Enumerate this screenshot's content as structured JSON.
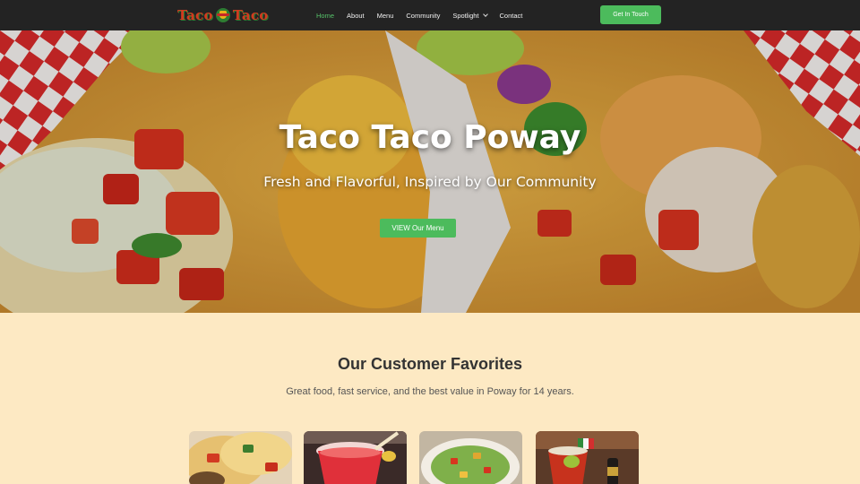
{
  "nav": {
    "logo_text_left": "Taco",
    "logo_text_right": "Taco",
    "items": [
      {
        "label": "Home",
        "active": true
      },
      {
        "label": "About",
        "active": false
      },
      {
        "label": "Menu",
        "active": false
      },
      {
        "label": "Community",
        "active": false
      },
      {
        "label": "Spotlight",
        "active": false,
        "dropdown": true
      },
      {
        "label": "Contact",
        "active": false
      }
    ],
    "cta_label": "Get In Touch"
  },
  "hero": {
    "title": "Taco Taco Poway",
    "subtitle": "Fresh and Flavorful, Inspired by Our Community",
    "button_label": "VIEW Our Menu"
  },
  "favorites": {
    "title": "Our Customer Favorites",
    "subtitle": "Great food, fast service, and the best value in Poway for 14 years.",
    "cards": [
      {
        "image": "tacos-plate-photo"
      },
      {
        "image": "red-drink-photo"
      },
      {
        "image": "salad-bowl-photo"
      },
      {
        "image": "michelada-with-flag-photo"
      }
    ]
  },
  "colors": {
    "nav_bg": "#232323",
    "accent_green": "#4cbb5c",
    "page_bg": "#fde9c3"
  }
}
